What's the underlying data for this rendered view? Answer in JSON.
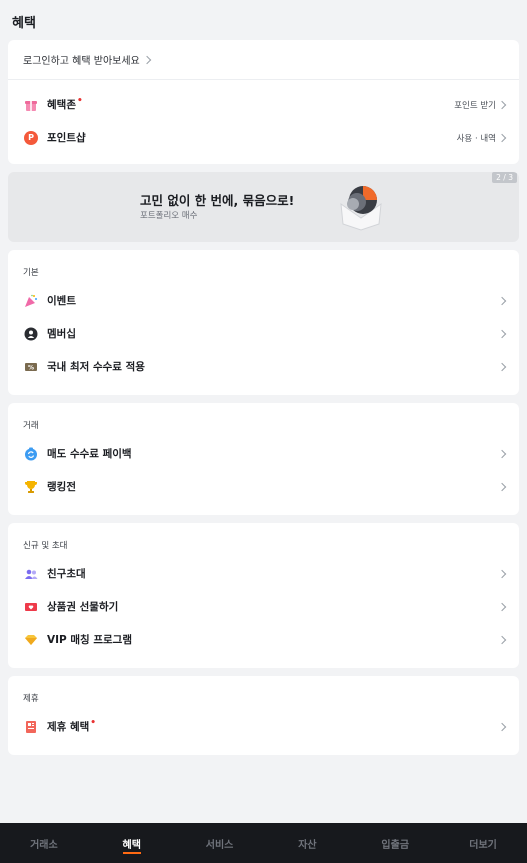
{
  "header": {
    "title": "혜택"
  },
  "top_card": {
    "login_prompt": "로그인하고 혜택 받아보세요",
    "items": [
      {
        "label": "혜택존",
        "badge_dot": "•",
        "right": "포인트 받기",
        "icon": "gift-icon"
      },
      {
        "label": "포인트샵",
        "right": "사용 · 내역",
        "icon": "point-icon",
        "icon_text": "P"
      }
    ]
  },
  "banner": {
    "title": "고민 없이 한 번에, 묶음으로!",
    "subtitle": "포트폴리오 매수",
    "pager": "2 / 3",
    "image": "bundle-illustration"
  },
  "sections": [
    {
      "title": "기본",
      "items": [
        {
          "label": "이벤트",
          "icon": "party-popper-icon"
        },
        {
          "label": "멤버십",
          "icon": "membership-icon"
        },
        {
          "label": "국내 최저 수수료 적용",
          "icon": "fee-coupon-icon"
        }
      ]
    },
    {
      "title": "거래",
      "items": [
        {
          "label": "매도 수수료 페이백",
          "icon": "payback-icon"
        },
        {
          "label": "랭킹전",
          "icon": "trophy-icon"
        }
      ]
    },
    {
      "title": "신규 및 초대",
      "items": [
        {
          "label": "친구초대",
          "icon": "friends-icon"
        },
        {
          "label": "상품권 선물하기",
          "icon": "gift-card-icon"
        },
        {
          "label": "VIP 매칭 프로그램",
          "icon": "diamond-icon"
        }
      ]
    },
    {
      "title": "제휴",
      "items": [
        {
          "label": "제휴 혜택",
          "badge_dot": "•",
          "icon": "partner-icon"
        }
      ]
    }
  ],
  "tabbar": {
    "tabs": [
      "거래소",
      "혜택",
      "서비스",
      "자산",
      "입출금",
      "더보기"
    ],
    "active": "혜택"
  },
  "colors": {
    "accent": "#ff6a13",
    "badge": "#e83333",
    "tabbar_bg": "#17191d"
  }
}
